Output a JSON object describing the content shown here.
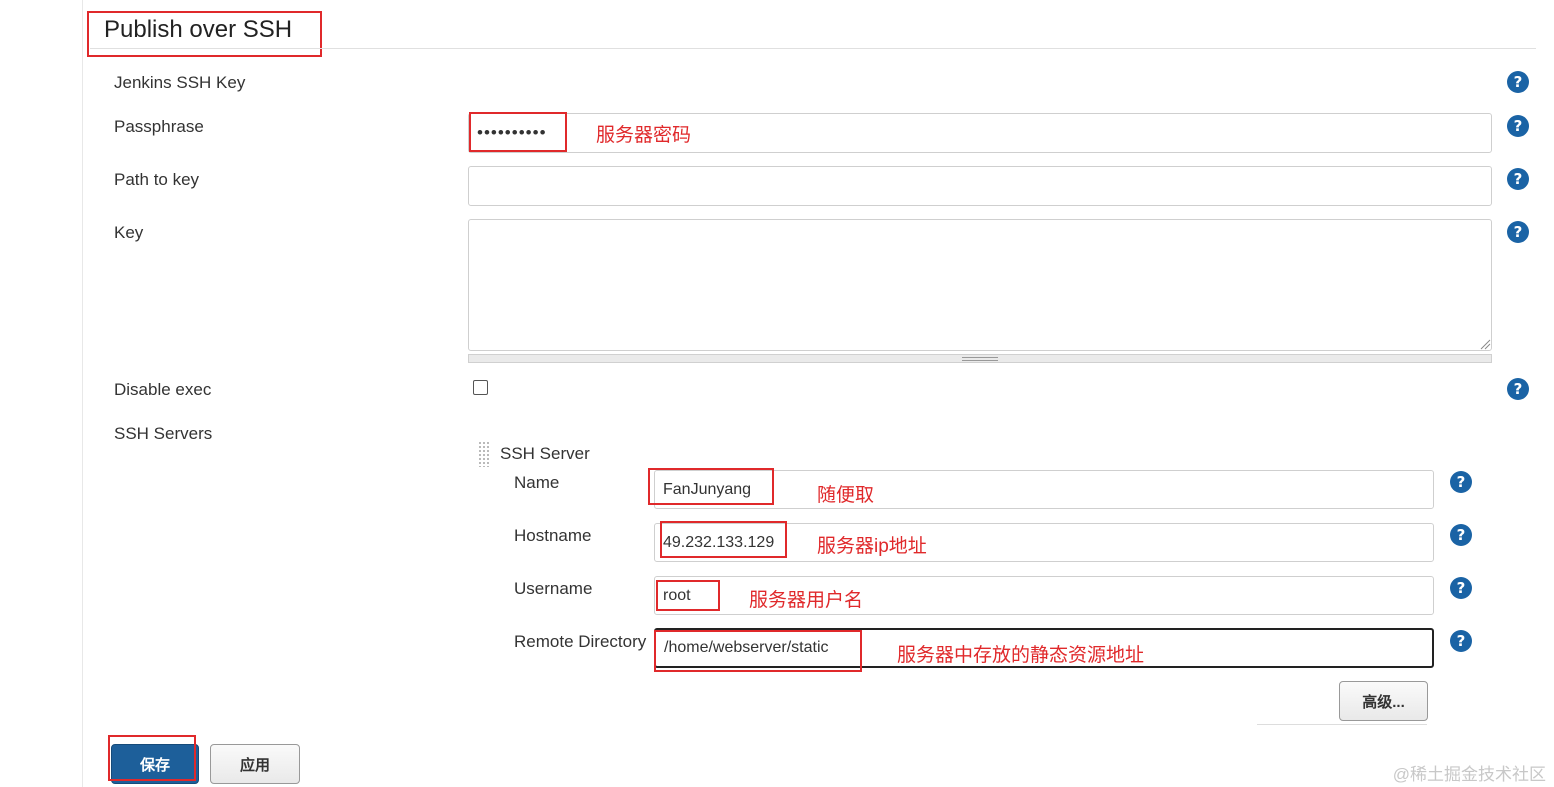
{
  "section": {
    "title": "Publish over SSH"
  },
  "fields": {
    "jenkins_ssh_key": {
      "label": "Jenkins SSH Key"
    },
    "passphrase": {
      "label": "Passphrase",
      "value": "••••••••••",
      "note": "服务器密码"
    },
    "path_to_key": {
      "label": "Path to key",
      "value": ""
    },
    "key": {
      "label": "Key",
      "value": ""
    },
    "disable_exec": {
      "label": "Disable exec",
      "checked": false
    },
    "ssh_servers": {
      "label": "SSH Servers"
    }
  },
  "ssh_server": {
    "header": "SSH Server",
    "name": {
      "label": "Name",
      "value": "FanJunyang",
      "note": "随便取"
    },
    "hostname": {
      "label": "Hostname",
      "value": "49.232.133.129",
      "note": "服务器ip地址"
    },
    "username": {
      "label": "Username",
      "value": "root",
      "note": "服务器用户名"
    },
    "remote_directory": {
      "label": "Remote Directory",
      "value": "/home/webserver/static",
      "note": "服务器中存放的静态资源地址"
    },
    "advanced_button": "高级..."
  },
  "help_glyph": "?",
  "buttons": {
    "save": "保存",
    "apply": "应用"
  },
  "watermark": "@稀土掘金技术社区",
  "colors": {
    "annotation_red": "#e0292b",
    "primary_blue": "#1d5f9a",
    "help_blue": "#1a63a5"
  }
}
